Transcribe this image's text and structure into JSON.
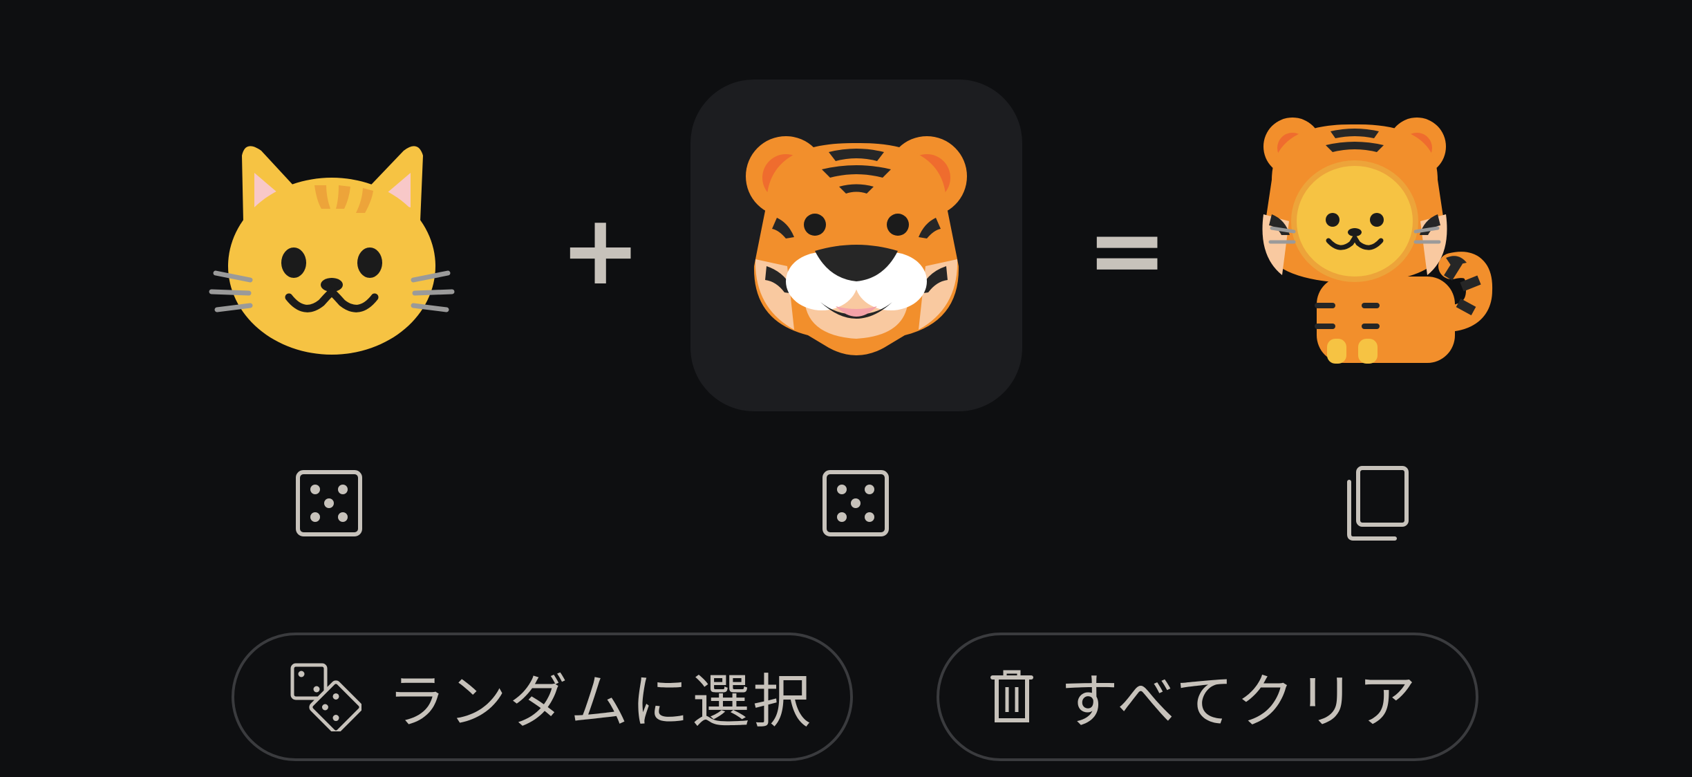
{
  "mixer": {
    "left_emoji": {
      "icon": "cat-face-emoji"
    },
    "middle_emoji": {
      "icon": "tiger-face-emoji",
      "selected": true
    },
    "result_emoji": {
      "icon": "cat-in-tiger-costume-emoji"
    },
    "plus_symbol": "+",
    "equals_symbol": "="
  },
  "controls": {
    "left_randomize_icon": "dice-icon",
    "middle_randomize_icon": "dice-icon",
    "copy_icon": "copy-icon"
  },
  "actions": {
    "random_label": "ランダムに選択",
    "random_icon": "dice-pair-icon",
    "clear_label": "すべてクリア",
    "clear_icon": "trash-icon"
  },
  "colors": {
    "background": "#0e0f11",
    "selected_tile": "#1c1d20",
    "icon_and_text": "#c7c2bb",
    "button_border": "#3a3b3e"
  }
}
